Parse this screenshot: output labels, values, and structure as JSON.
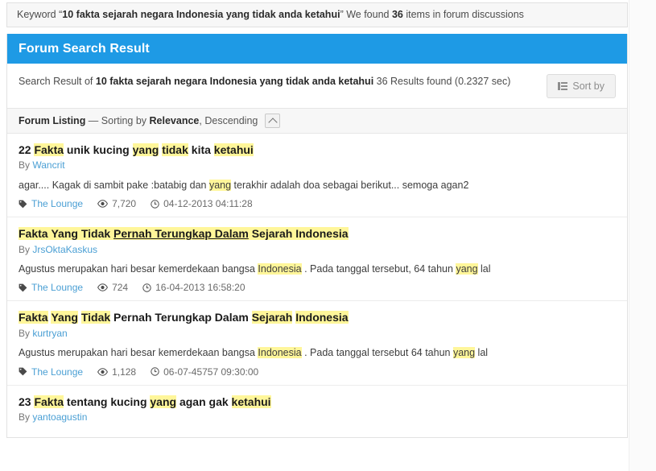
{
  "keyword_bar": {
    "prefix": "Keyword “",
    "keyword": "10 fakta sejarah negara Indonesia yang tidak anda ketahui",
    "middle": "” We found ",
    "count": "36",
    "suffix": " items in forum discussions"
  },
  "panel": {
    "title": "Forum Search Result",
    "summary_prefix": "Search Result of ",
    "summary_keyword": "10 fakta sejarah negara Indonesia yang tidak anda ketahui",
    "summary_suffix": " 36 Results found (0.2327 sec)",
    "sort_button": {
      "label": "Sort by",
      "icon": "grid-list-icon"
    }
  },
  "listing_bar": {
    "label": "Forum Listing",
    "separator": " — Sorting by ",
    "sort_field": "Relevance",
    "sort_direction": ", Descending",
    "collapse_icon": "chevron-up-icon"
  },
  "accent_colors": {
    "header_blue": "#1e9ae5",
    "highlight_yellow": "#fff69a",
    "link_blue": "#4a9fd4",
    "bar_grey": "#f7f7f7"
  },
  "meta_icons": {
    "forum": "tag-icon",
    "views": "eye-icon",
    "date": "clock-icon"
  },
  "results": [
    {
      "title_parts": [
        {
          "t": "22 ",
          "h": false
        },
        {
          "t": "Fakta",
          "h": true
        },
        {
          "t": " unik kucing ",
          "h": false
        },
        {
          "t": "yang",
          "h": true
        },
        {
          "t": " ",
          "h": false
        },
        {
          "t": "tidak",
          "h": true
        },
        {
          "t": " kita ",
          "h": false
        },
        {
          "t": "ketahui",
          "h": true
        }
      ],
      "by_prefix": "By ",
      "author": "Wancrit",
      "snippet_parts": [
        {
          "t": "agar.... Kagak di sambit pake :batabig dan ",
          "h": false
        },
        {
          "t": "yang",
          "h": true
        },
        {
          "t": " terakhir adalah doa sebagai berikut... semoga agan2",
          "h": false
        }
      ],
      "forum": "The Lounge",
      "views": "7,720",
      "date": "04-12-2013 04:11:28"
    },
    {
      "title_parts": [
        {
          "t": "Fakta",
          "h": true
        },
        {
          "t": " ",
          "h": true
        },
        {
          "t": "Yang",
          "h": true
        },
        {
          "t": " ",
          "h": true
        },
        {
          "t": "Tidak",
          "h": true
        },
        {
          "t": " ",
          "h": true
        },
        {
          "t": "Pernah Terungkap Dalam",
          "h": true,
          "u": true
        },
        {
          "t": " ",
          "h": true
        },
        {
          "t": "Sejarah",
          "h": true
        },
        {
          "t": " ",
          "h": true
        },
        {
          "t": "Indonesia",
          "h": true
        }
      ],
      "by_prefix": "By ",
      "author": "JrsOktaKaskus",
      "snippet_parts": [
        {
          "t": "Agustus merupakan hari besar kemerdekaan bangsa ",
          "h": false
        },
        {
          "t": "Indonesia",
          "h": true
        },
        {
          "t": " . Pada tanggal tersebut, 64 tahun ",
          "h": false
        },
        {
          "t": "yang",
          "h": true
        },
        {
          "t": " lal",
          "h": false
        }
      ],
      "forum": "The Lounge",
      "views": "724",
      "date": "16-04-2013 16:58:20"
    },
    {
      "title_parts": [
        {
          "t": "Fakta",
          "h": true
        },
        {
          "t": " ",
          "h": false
        },
        {
          "t": "Yang",
          "h": true
        },
        {
          "t": " ",
          "h": false
        },
        {
          "t": "Tidak",
          "h": true
        },
        {
          "t": " Pernah Terungkap Dalam ",
          "h": false
        },
        {
          "t": "Sejarah",
          "h": true
        },
        {
          "t": " ",
          "h": false
        },
        {
          "t": "Indonesia",
          "h": true
        }
      ],
      "by_prefix": "By ",
      "author": "kurtryan",
      "snippet_parts": [
        {
          "t": "Agustus merupakan hari besar kemerdekaan bangsa ",
          "h": false
        },
        {
          "t": "Indonesia",
          "h": true
        },
        {
          "t": " . Pada tanggal tersebut 64 tahun ",
          "h": false
        },
        {
          "t": "yang",
          "h": true
        },
        {
          "t": " lal",
          "h": false
        }
      ],
      "forum": "The Lounge",
      "views": "1,128",
      "date": "06-07-45757 09:30:00"
    },
    {
      "title_parts": [
        {
          "t": "23 ",
          "h": false
        },
        {
          "t": "Fakta",
          "h": true
        },
        {
          "t": " tentang kucing ",
          "h": false
        },
        {
          "t": "yang",
          "h": true
        },
        {
          "t": " agan gak ",
          "h": false
        },
        {
          "t": "ketahui",
          "h": true
        }
      ],
      "by_prefix": "By ",
      "author": "yantoagustin",
      "snippet_parts": [],
      "forum": "",
      "views": "",
      "date": ""
    }
  ]
}
